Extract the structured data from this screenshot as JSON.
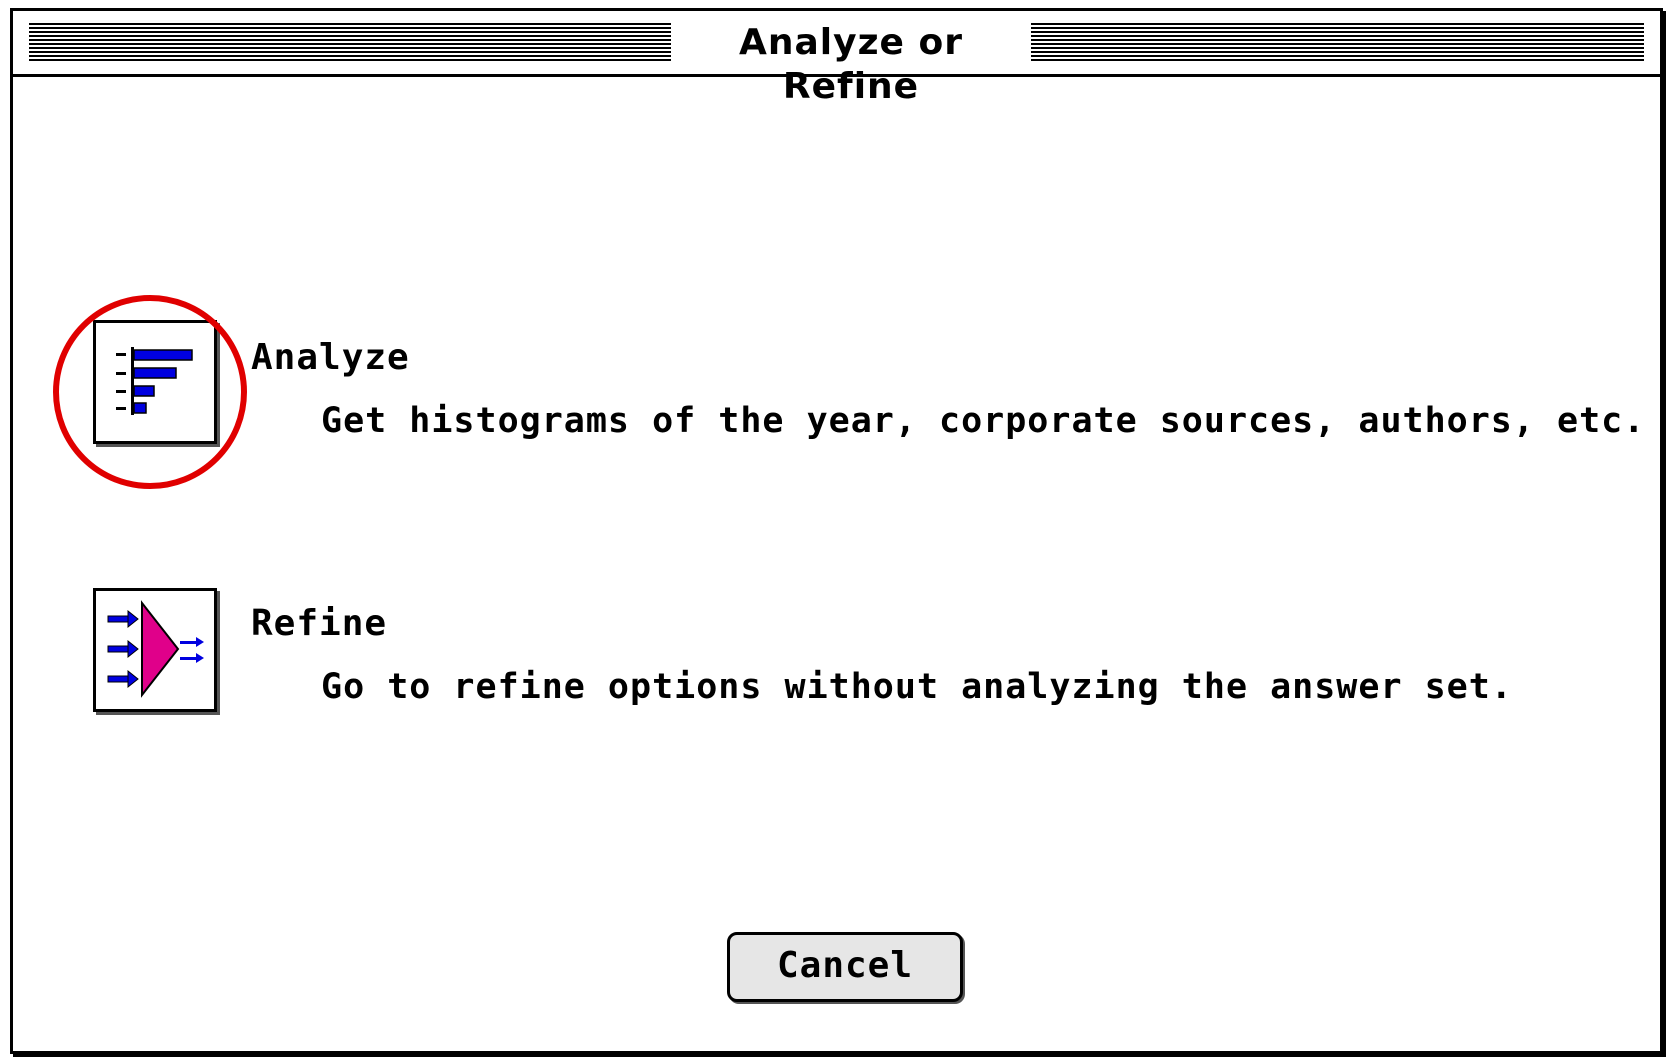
{
  "window": {
    "title": "Analyze or Refine"
  },
  "options": {
    "analyze": {
      "label": "Analyze",
      "description": "Get histograms of the year, corporate sources, authors, etc.",
      "icon": "histogram-icon"
    },
    "refine": {
      "label": "Refine",
      "description": "Go to refine options without analyzing the answer set.",
      "icon": "refine-funnel-icon"
    }
  },
  "buttons": {
    "cancel_label": "Cancel"
  },
  "colors": {
    "highlight_ring": "#e00000",
    "icon_blue": "#0000e0",
    "icon_magenta": "#e0008a"
  }
}
